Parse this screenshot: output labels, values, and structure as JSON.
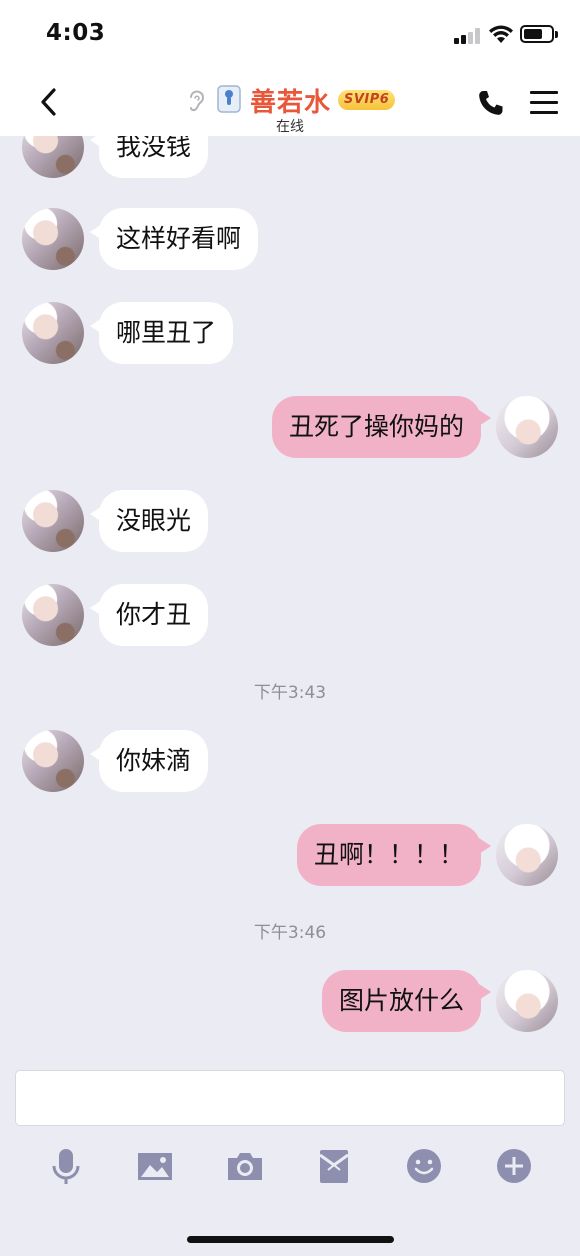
{
  "status_bar": {
    "time": "4:03"
  },
  "header": {
    "contact_name": "善若水",
    "badge": "SVIP6",
    "status": "在线"
  },
  "messages": [
    {
      "side": "left",
      "text": "我没钱"
    },
    {
      "side": "left",
      "text": "这样好看啊"
    },
    {
      "side": "left",
      "text": "哪里丑了"
    },
    {
      "side": "right",
      "text": "丑死了操你妈的"
    },
    {
      "side": "left",
      "text": "没眼光"
    },
    {
      "side": "left",
      "text": "你才丑"
    },
    {
      "side": "time",
      "text": "下午3:43"
    },
    {
      "side": "left",
      "text": "你妹滴"
    },
    {
      "side": "right",
      "text": "丑啊！！！！"
    },
    {
      "side": "time",
      "text": "下午3:46"
    },
    {
      "side": "right",
      "text": "图片放什么"
    }
  ],
  "input": {
    "value": "",
    "placeholder": ""
  },
  "toolbar": [
    "microphone-icon",
    "image-icon",
    "camera-icon",
    "red-packet-icon",
    "emoji-icon",
    "plus-icon"
  ],
  "colors": {
    "background": "#ebebf3",
    "incoming_bubble": "#ffffff",
    "outgoing_bubble": "#f1b2c8",
    "name": "#e8573a",
    "toolbar_icons": "#8e8fae"
  }
}
